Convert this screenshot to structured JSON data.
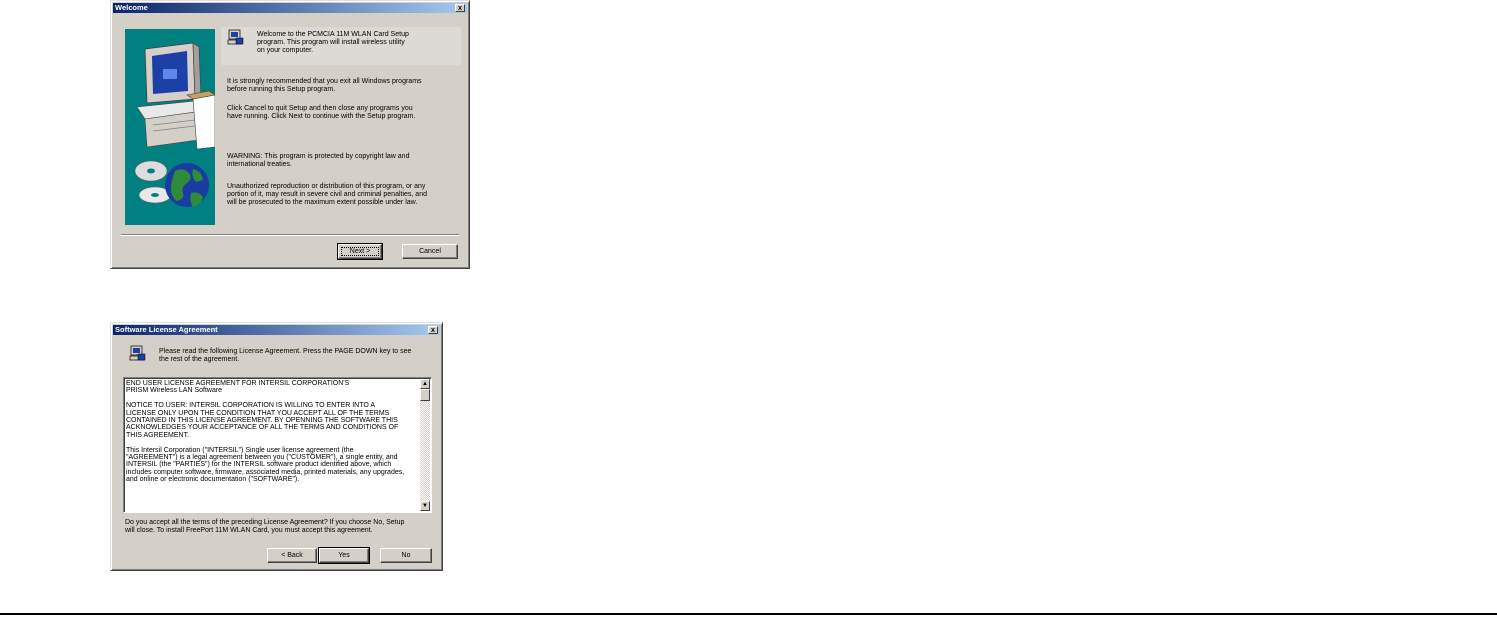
{
  "welcome": {
    "title": "Welcome",
    "intro": "Welcome to the PCMCIA 11M WLAN Card Setup\nprogram. This program will install wireless utility\non your computer.",
    "p1": "It is strongly recommended that you exit all Windows programs\nbefore running this Setup program.",
    "p2": "Click Cancel to quit Setup and then close any programs you\nhave running.  Click Next to continue with the Setup program.",
    "p3": "WARNING: This program is protected by copyright law and\ninternational treaties.",
    "p4": "Unauthorized reproduction or distribution of this program, or any\nportion of it, may result in severe civil and criminal penalties, and\nwill be prosecuted to the maximum extent possible under law.",
    "next_label": "Next >",
    "cancel_label": "Cancel",
    "close_label": "x"
  },
  "license": {
    "title": "Software License Agreement",
    "instructions": "Please read the following License Agreement.  Press the PAGE DOWN key to see\nthe rest of the agreement.",
    "agreement_text": "END USER LICENSE AGREEMENT FOR INTERSIL CORPORATION'S\nPRISM Wireless LAN Software\n\nNOTICE TO USER: INTERSIL CORPORATION IS WILLING TO ENTER INTO A\nLICENSE ONLY UPON THE CONDITION THAT YOU ACCEPT ALL OF THE TERMS\nCONTAINED IN THIS LICENSE AGREEMENT. BY OPENNING THE SOFTWARE THIS\nACKNOWLEDGES YOUR ACCEPTANCE OF ALL THE TERMS AND CONDITIONS OF\nTHIS AGREEMENT.\n\nThis Intersil Corporation (\"INTERSIL\") Single user license agreement (the\n\"AGREEMENT\") is a legal agreement between you (\"CUSTOMER\"), a single entity, and\nINTERSIL (the \"PARTIES\") for the INTERSIL software product identified above, which\nincludes computer software, firmware, associated media, printed materials, any upgrades,\nand online or electronic documentation (\"SOFTWARE\").",
    "question": "Do you accept all the terms of the preceding License Agreement?  If you choose No,  Setup\nwill close.  To install FreePort 11M WLAN Card, you must accept this agreement.",
    "back_label": "< Back",
    "yes_label": "Yes",
    "no_label": "No",
    "close_label": "x"
  },
  "colors": {
    "titlebar_start": "#0a246a",
    "titlebar_end": "#a6caf0",
    "dialog_face": "#d4d0c8",
    "graphic_teal": "#008080"
  }
}
